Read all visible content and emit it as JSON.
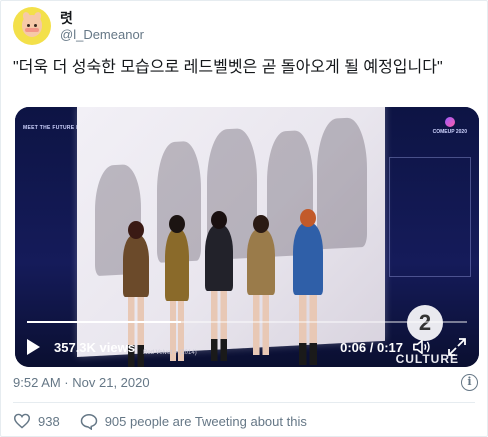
{
  "user": {
    "display_name": "렷",
    "handle": "@l_Demeanor",
    "avatar": "cat-cartoon-avatar"
  },
  "tweet": {
    "text": "\"더욱 더 성숙한 모습으로 레드벨벳은 곧 돌아오게 될 예정입니다\"",
    "timestamp": "9:52 AM · Nov 21, 2020"
  },
  "video": {
    "views": "357.3K views",
    "time_display": "0:06 / 0:17",
    "progress_fraction": 0.35,
    "caption": "Red Velvet -- (2014)",
    "overlay_badge": "2",
    "overlay_text": "CULTURE",
    "logo_left": "MEET THE FUTURE POST - PANDEMIC",
    "logo_right": "COMEUP 2020",
    "icons": [
      "play-icon",
      "volume-icon",
      "fullscreen-icon"
    ]
  },
  "actions": {
    "like_count": "938",
    "tweeting_text": "905 people are Tweeting about this",
    "icons": [
      "heart-icon",
      "chat-bubble-icon",
      "info-icon"
    ]
  },
  "colors": {
    "secondary_text": "#657786",
    "primary_text": "#14171a",
    "border": "#e6ecf0",
    "avatar_bg": "#f3e04a"
  }
}
